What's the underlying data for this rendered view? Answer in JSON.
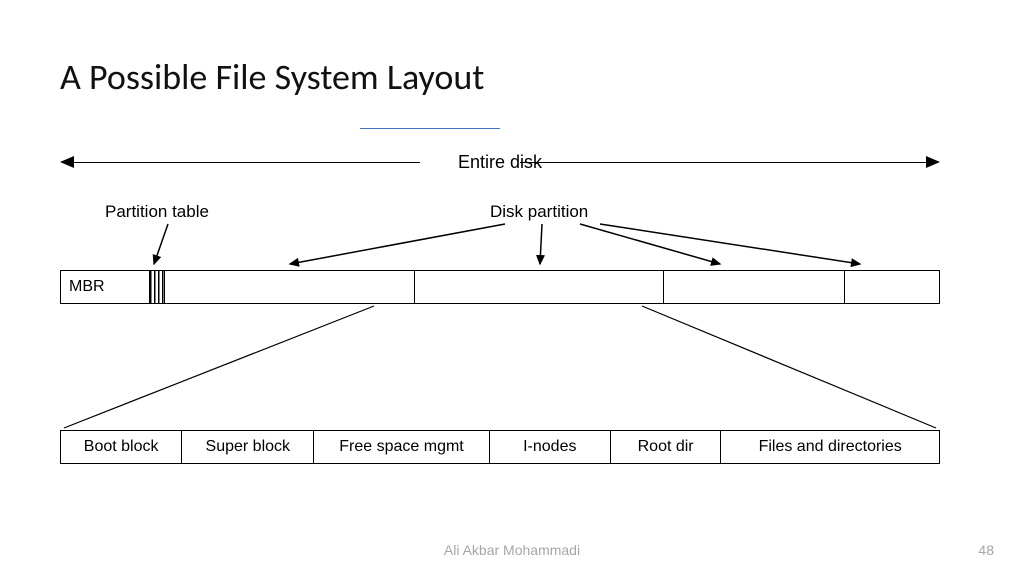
{
  "title": "A Possible File System Layout",
  "footer": {
    "author": "Ali Akbar Mohammadi",
    "page": "48"
  },
  "labels": {
    "entire_disk": "Entire disk",
    "partition_table": "Partition table",
    "disk_partition": "Disk partition",
    "mbr": "MBR"
  },
  "detail": {
    "boot": "Boot block",
    "super": "Super block",
    "free": "Free space mgmt",
    "inodes": "I-nodes",
    "root": "Root dir",
    "files": "Files and directories"
  }
}
